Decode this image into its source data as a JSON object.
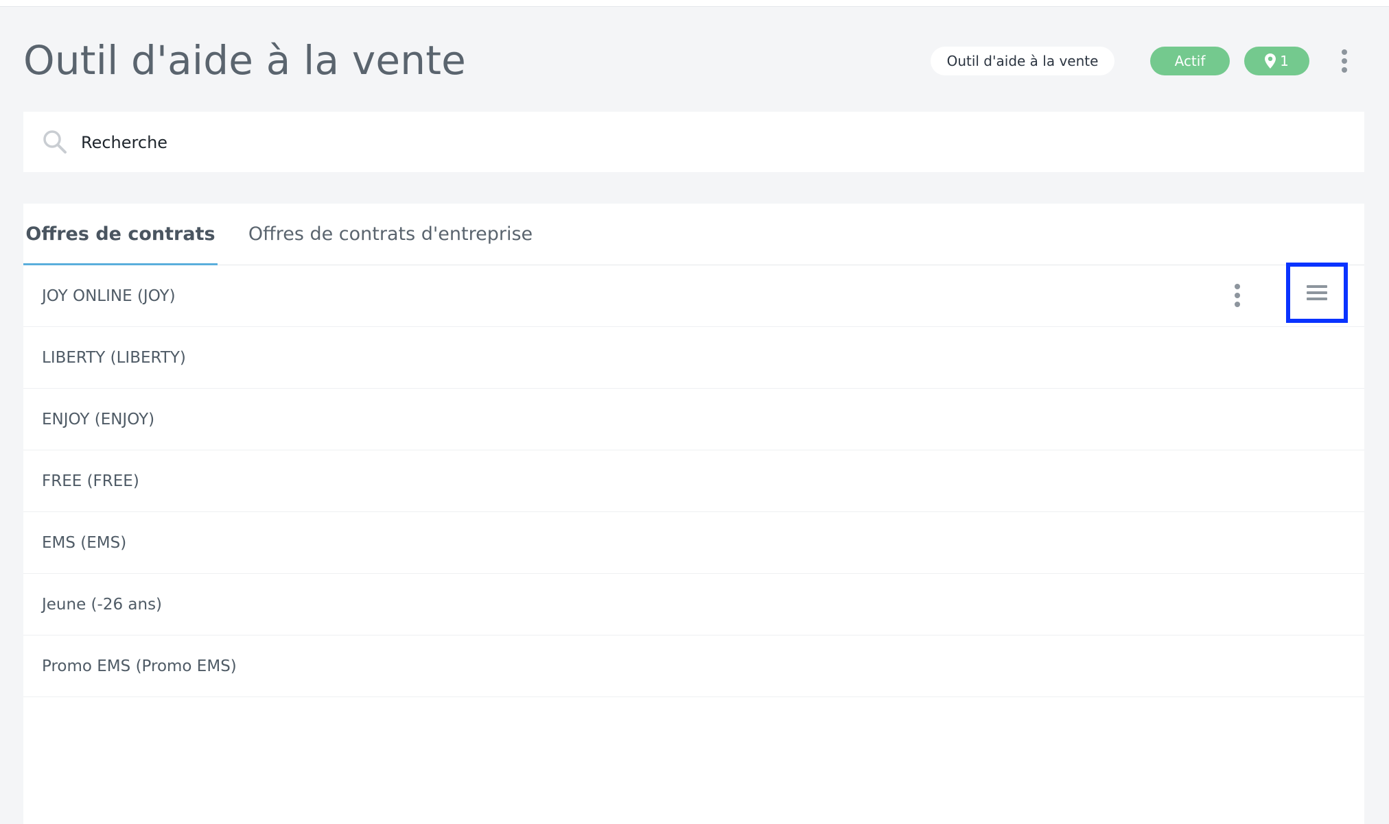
{
  "header": {
    "title": "Outil d'aide à la vente",
    "tool_chip": "Outil d'aide à la vente",
    "status_chip": "Actif",
    "location_count": "1",
    "more_icon": "vertical-ellipsis-icon"
  },
  "search": {
    "placeholder": "Recherche",
    "value": "",
    "icon": "search-icon"
  },
  "tabs": [
    {
      "label": "Offres de contrats",
      "active": true
    },
    {
      "label": "Offres de contrats d'entreprise",
      "active": false
    }
  ],
  "list": {
    "items": [
      {
        "label": "JOY ONLINE (JOY)"
      },
      {
        "label": "LIBERTY (LIBERTY)"
      },
      {
        "label": "ENJOY (ENJOY)"
      },
      {
        "label": "FREE (FREE)"
      },
      {
        "label": "EMS (EMS)"
      },
      {
        "label": "Jeune (-26 ans)"
      },
      {
        "label": "Promo EMS (Promo EMS)"
      }
    ],
    "row_actions_icon": "vertical-ellipsis-icon",
    "drag_handle_icon": "drag-handle-icon"
  },
  "colors": {
    "accent": "#5aaedc",
    "status_green": "#74c98e",
    "highlight": "#0a33ff"
  }
}
